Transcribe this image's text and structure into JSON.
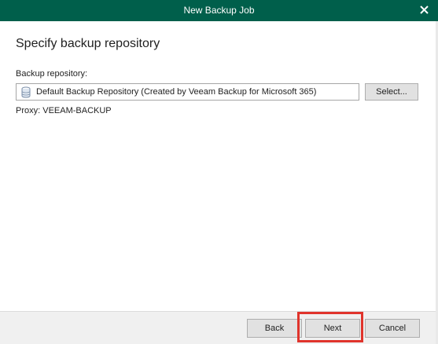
{
  "window": {
    "title": "New Backup Job",
    "close_icon": "close-icon"
  },
  "page": {
    "heading": "Specify backup repository"
  },
  "repository": {
    "label": "Backup repository:",
    "icon": "database-icon",
    "value": "Default Backup Repository (Created by Veeam Backup for Microsoft 365)",
    "select_label": "Select..."
  },
  "proxy": {
    "text": "Proxy: VEEAM-BACKUP"
  },
  "footer": {
    "back_label": "Back",
    "next_label": "Next",
    "cancel_label": "Cancel"
  },
  "colors": {
    "titlebar": "#005f4b",
    "highlight": "#e0342c"
  }
}
